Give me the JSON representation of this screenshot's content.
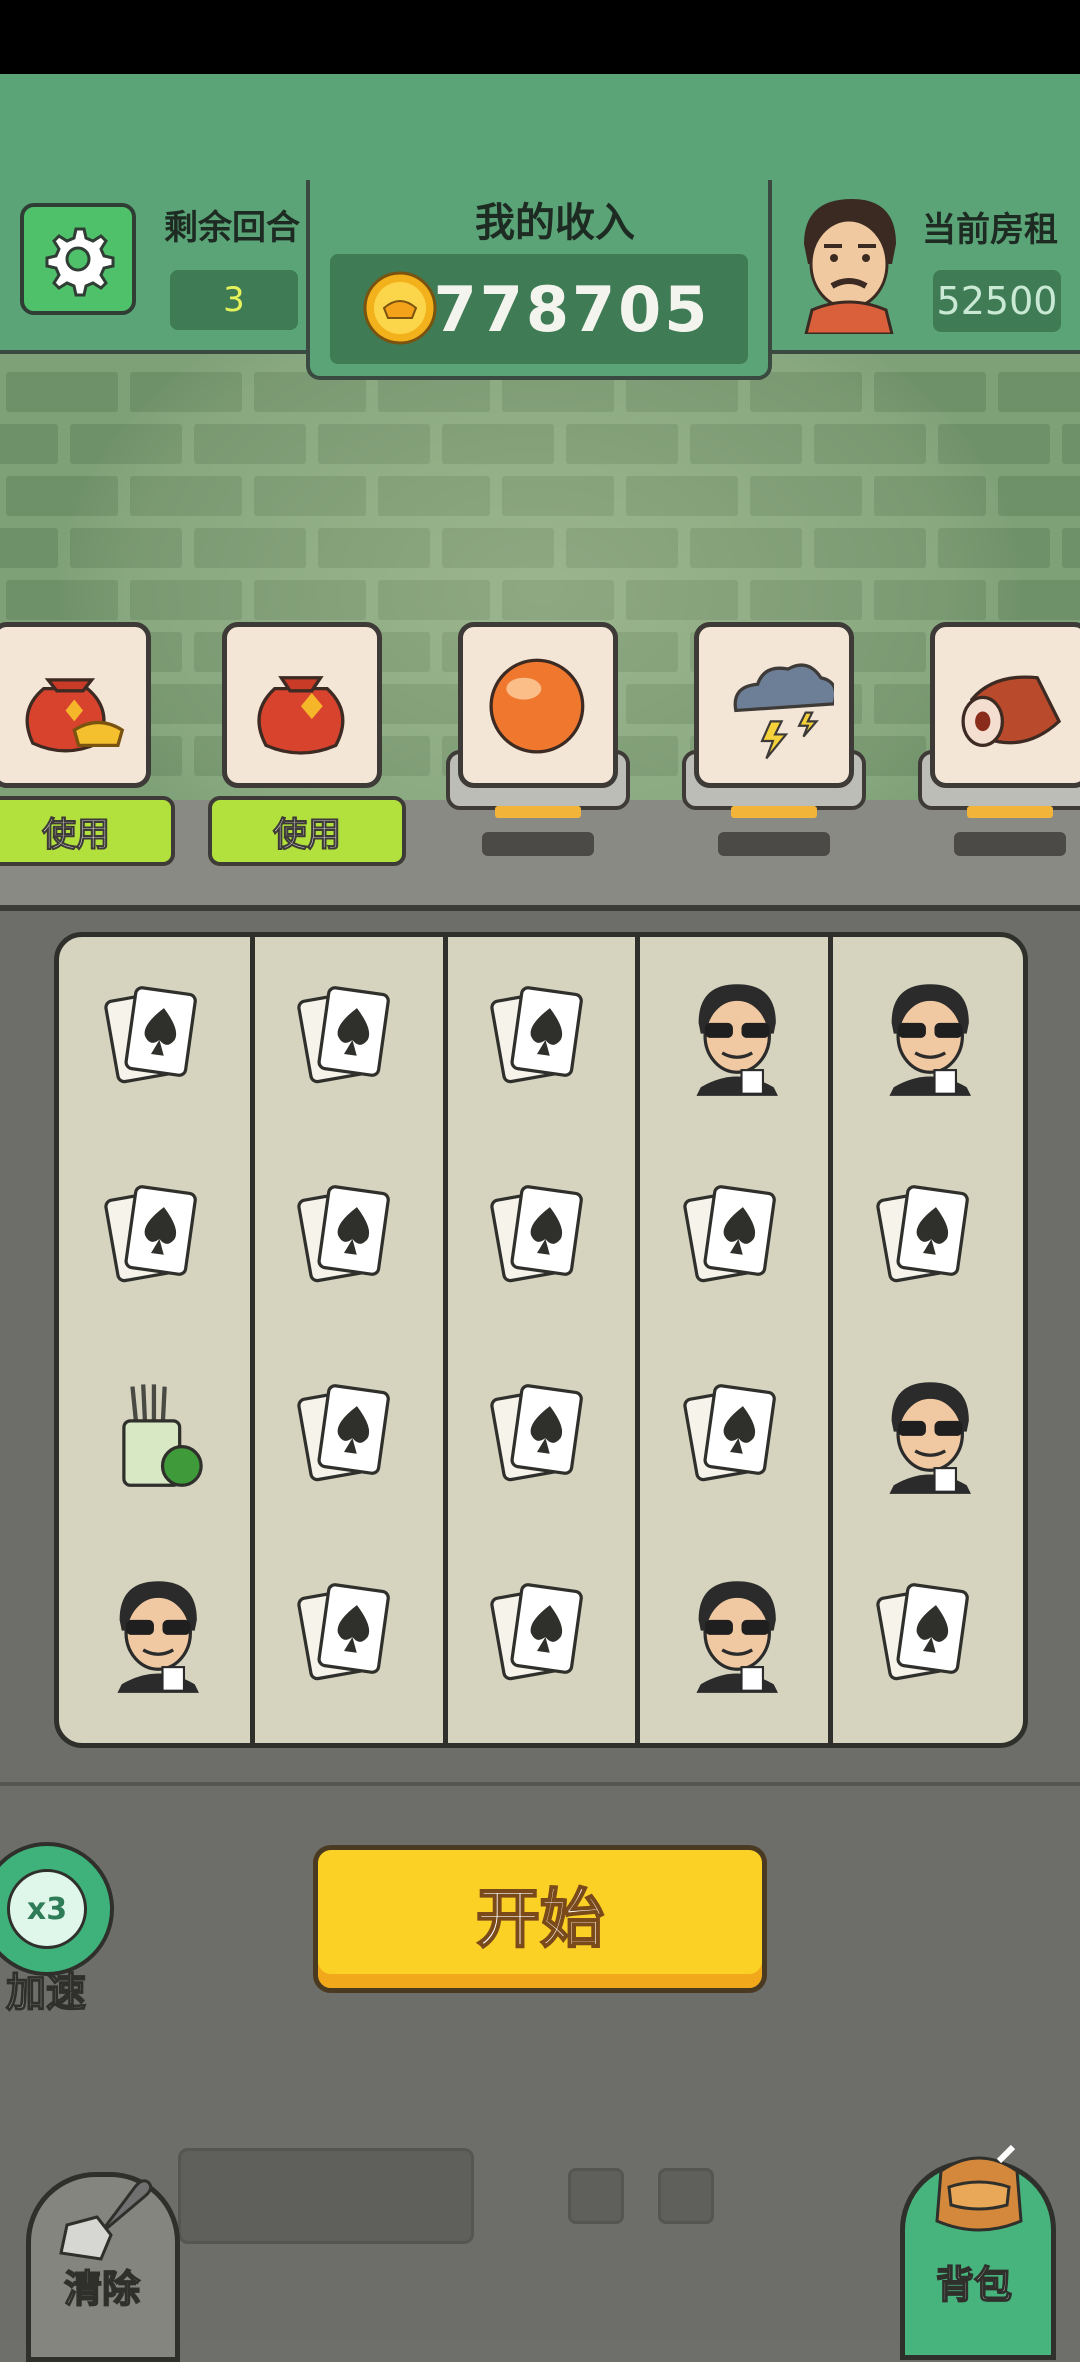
{
  "header": {
    "rounds_label": "剩余回合",
    "rounds_value": "3",
    "income_title": "我的收入",
    "income_value": "778705",
    "rent_label": "当前房租",
    "rent_value": "52500"
  },
  "items": [
    {
      "icon": "money-bag-gold-icon",
      "action": "使用"
    },
    {
      "icon": "red-lucky-bag-icon",
      "action": "使用"
    },
    {
      "icon": "orange-orb-icon"
    },
    {
      "icon": "storm-cloud-icon"
    },
    {
      "icon": "meat-icon"
    }
  ],
  "grid": {
    "columns": 5,
    "rows": 4,
    "cells": [
      [
        "cards",
        "cards",
        "cards",
        "dealer",
        "dealer"
      ],
      [
        "cards",
        "cards",
        "cards",
        "cards",
        "cards"
      ],
      [
        "pot",
        "cards",
        "cards",
        "cards",
        "dealer"
      ],
      [
        "dealer",
        "cards",
        "cards",
        "dealer",
        "cards"
      ]
    ]
  },
  "controls": {
    "start_label": "开始",
    "speed_badge": "x3",
    "speed_label": "加速",
    "clear_label": "清除",
    "bag_label": "背包"
  },
  "colors": {
    "header_green": "#5aa477",
    "start_yellow": "#fbd125",
    "use_green": "#b2e03c"
  }
}
